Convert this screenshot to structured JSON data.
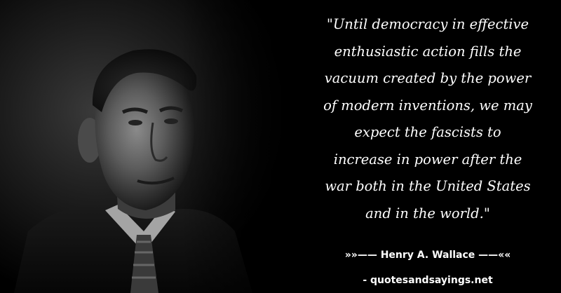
{
  "quote": {
    "lines": [
      "\"Until democracy in effective",
      "enthusiastic action fills the",
      "vacuum created by the power",
      "of modern inventions, we may",
      "expect the fascists to",
      "increase in power after the",
      "war both in the United States",
      "and in the world.\""
    ]
  },
  "attribution": {
    "text": "»»—— Henry A. Wallace ——««"
  },
  "source": {
    "text": "- quotesandsayings.net"
  },
  "colors": {
    "background": "#000000",
    "text": "#ffffff"
  }
}
